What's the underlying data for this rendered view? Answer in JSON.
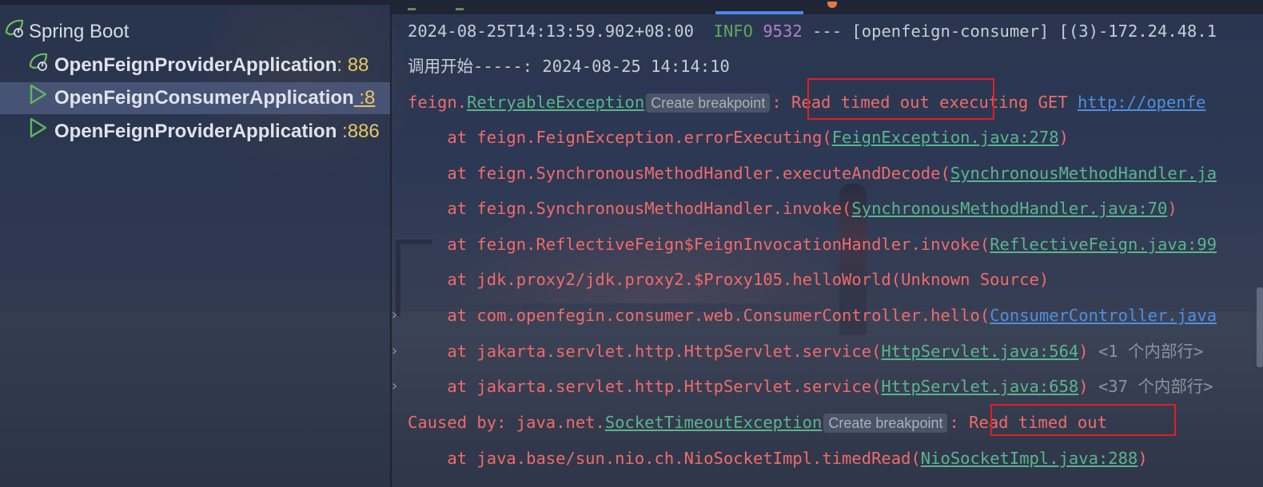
{
  "tree": {
    "root_label": "Spring Boot",
    "items": [
      {
        "name": "OpenFeignProviderApplication",
        "port": ":  88"
      },
      {
        "name": "OpenFeignConsumerApplication",
        "port": " :8"
      },
      {
        "name": "OpenFeignProviderApplication",
        "port": " :886"
      }
    ]
  },
  "console": {
    "lines": [
      {
        "ts": "2024-08-25T14:13:59.902+08:00",
        "level": "INFO",
        "pid": "9532",
        "rest": " --- [openfeign-consumer] [(3)-172.24.48.1"
      },
      {
        "text": "调用开始-----: 2024-08-25 14:14:10"
      }
    ],
    "exception": {
      "prefix": "feign.",
      "class": "RetryableException",
      "chip": "Create breakpoint",
      "message_pre": ": ",
      "message": "Read timed out executing GET ",
      "url": "http://openfe"
    },
    "stack": [
      {
        "pre": "    at feign.FeignException.errorExecuting(",
        "link": "FeignException.java:278",
        "post": ")"
      },
      {
        "pre": "    at feign.SynchronousMethodHandler.executeAndDecode(",
        "link": "SynchronousMethodHandler.ja",
        "post": ""
      },
      {
        "pre": "    at feign.SynchronousMethodHandler.invoke(",
        "link": "SynchronousMethodHandler.java:70",
        "post": ")"
      },
      {
        "pre": "    at feign.ReflectiveFeign$FeignInvocationHandler.invoke(",
        "link": "ReflectiveFeign.java:99",
        "post": ""
      },
      {
        "pre": "    at jdk.proxy2/jdk.proxy2.$Proxy105.helloWorld(Unknown Source)",
        "link": "",
        "post": ""
      },
      {
        "pre": "    at com.openfegin.consumer.web.ConsumerController.hello(",
        "link": "ConsumerController.java",
        "post": "",
        "blue": true,
        "fold": true
      },
      {
        "pre": "    at jakarta.servlet.http.HttpServlet.service(",
        "link": "HttpServlet.java:564",
        "post": ")",
        "note": " <1 个内部行>",
        "fold": true
      },
      {
        "pre": "    at jakarta.servlet.http.HttpServlet.service(",
        "link": "HttpServlet.java:658",
        "post": ")",
        "note": " <37 个内部行>",
        "fold": true
      }
    ],
    "caused": {
      "prefix": "Caused by: java.net.",
      "class": "SocketTimeoutException",
      "chip": "Create breakpoint",
      "message_pre": ": ",
      "message": "Read timed out"
    },
    "last": {
      "pre": "    at java.base/sun.nio.ch.NioSocketImpl.timedRead(",
      "link": "NioSocketImpl.java:288",
      "post": ")"
    }
  },
  "colors": {
    "error": "#f06b6b",
    "info": "#5fa85a",
    "link": "#5ab58c",
    "highlight_box": "#e02020"
  }
}
